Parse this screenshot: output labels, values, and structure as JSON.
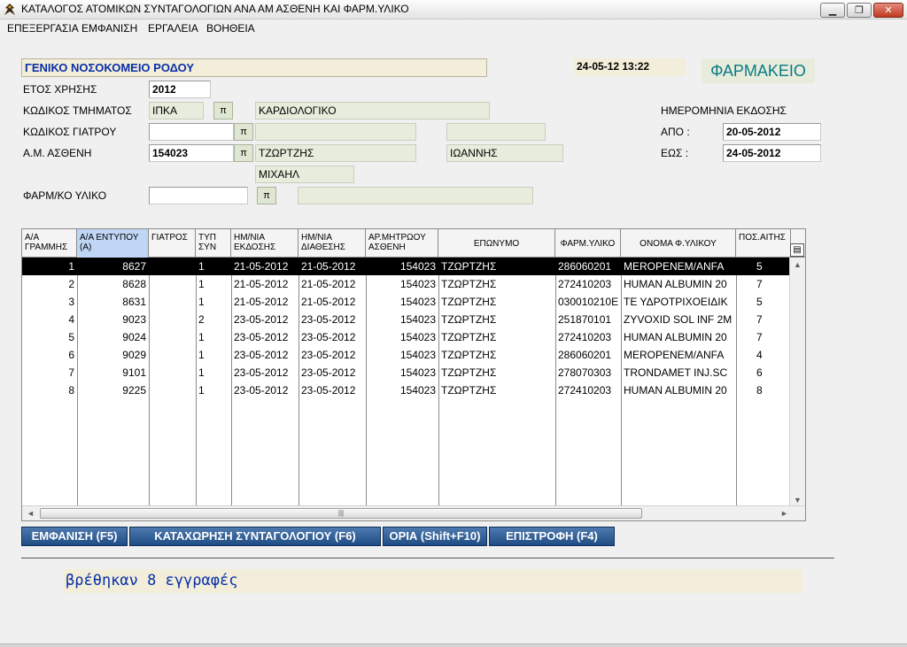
{
  "window": {
    "title": "ΚΑΤΑΛΟΓΟΣ  ΑΤΟΜΙΚΩΝ  ΣΥΝΤΑΓΟΛΟΓΙΩΝ  ΑΝΑ ΑΜ ΑΣΘΕΝΗ ΚΑΙ ΦΑΡΜ.ΥΛΙΚΟ",
    "minimize": "▁",
    "maximize": "❐",
    "close": "✕"
  },
  "menu": [
    "ΕΠΕΞΕΡΓΑΣΙΑ",
    "ΕΜΦΑΝΙΣΗ",
    "ΕΡΓΑΛΕΙΑ",
    "ΒΟΗΘΕΙΑ"
  ],
  "header": {
    "hospital": "ΓΕΝΙΚΟ ΝΟΣΟΚΟΜΕΙΟ ΡΟΔΟΥ",
    "datetime": "24-05-12 13:22",
    "pharmacy": "ΦΑΡΜΑΚΕΙΟ"
  },
  "form": {
    "year_label": "ΕΤΟΣ ΧΡΗΣΗΣ",
    "year_value": "2012",
    "dept_label": "ΚΩΔΙΚΟΣ ΤΜΗΜΑΤΟΣ",
    "dept_code": "ΙΠΚΑ",
    "dept_name": "ΚΑΡΔΙΟΛΟΓΙΚΟ",
    "doctor_label": "ΚΩΔΙΚΟΣ ΓΙΑΤΡΟΥ",
    "doctor_code": "",
    "doctor_surname": "",
    "doctor_firstname": "",
    "patient_label": "Α.Μ. ΑΣΘΕΝΗ",
    "patient_am": "154023",
    "patient_surname": "ΤΖΩΡΤΖΗΣ",
    "patient_firstname": "ΙΩΑΝΝΗΣ",
    "patient_father": "ΜΙΧΑΗΛ",
    "material_label": "ΦΑΡΜ/ΚΟ ΥΛΙΚΟ",
    "material_code": "",
    "material_name": "",
    "lookup_btn": "π",
    "issue_date_label": "ΗΜΕΡΟΜΗΝΙΑ ΕΚΔΟΣΗΣ",
    "from_label": "ΑΠΟ   :",
    "from_value": "20-05-2012",
    "to_label": "ΕΩΣ   :",
    "to_value": "24-05-2012"
  },
  "grid": {
    "columns": [
      "Α/Α ΓΡΑΜΜΗΣ",
      "Α/Α ΕΝΤΥΠΟΥ (Α)",
      "ΓΙΑΤΡΟΣ",
      "ΤΥΠ ΣΥΝ",
      "ΗΜ/ΝΙΑ ΕΚΔΟΣΗΣ",
      "ΗΜ/ΝΙΑ ΔΙΑΘΕΣΗΣ",
      "ΑΡ.ΜΗΤΡΩΟΥ ΑΣΘΕΝΗ",
      "ΕΠΩΝΥΜΟ",
      "ΦΑΡΜ.ΥΛΙΚΟ",
      "ΟΝΟΜΑ Φ.ΥΛΙΚΟΥ",
      "ΠΟΣ.ΑΙΤΗΣ"
    ],
    "rows": [
      [
        "1",
        "8627",
        "",
        "1",
        "21-05-2012",
        "21-05-2012",
        "154023",
        "ΤΖΩΡΤΖΗΣ",
        "286060201",
        "MEROPENEM/ANFA",
        "5"
      ],
      [
        "2",
        "8628",
        "",
        "1",
        "21-05-2012",
        "21-05-2012",
        "154023",
        "ΤΖΩΡΤΖΗΣ",
        "272410203",
        "HUMAN ALBUMIN 20",
        "7"
      ],
      [
        "3",
        "8631",
        "",
        "1",
        "21-05-2012",
        "21-05-2012",
        "154023",
        "ΤΖΩΡΤΖΗΣ",
        "030010210E",
        "ΤΕ ΥΔΡΟΤΡΙΧΟΕΙΔΙΚ",
        "5"
      ],
      [
        "4",
        "9023",
        "",
        "2",
        "23-05-2012",
        "23-05-2012",
        "154023",
        "ΤΖΩΡΤΖΗΣ",
        "251870101",
        "ZYVOXID SOL INF 2M",
        "7"
      ],
      [
        "5",
        "9024",
        "",
        "1",
        "23-05-2012",
        "23-05-2012",
        "154023",
        "ΤΖΩΡΤΖΗΣ",
        "272410203",
        "HUMAN ALBUMIN 20",
        "7"
      ],
      [
        "6",
        "9029",
        "",
        "1",
        "23-05-2012",
        "23-05-2012",
        "154023",
        "ΤΖΩΡΤΖΗΣ",
        "286060201",
        "MEROPENEM/ANFA",
        "4"
      ],
      [
        "7",
        "9101",
        "",
        "1",
        "23-05-2012",
        "23-05-2012",
        "154023",
        "ΤΖΩΡΤΖΗΣ",
        "278070303",
        "TRONDAMET INJ.SC",
        "6"
      ],
      [
        "8",
        "9225",
        "",
        "1",
        "23-05-2012",
        "23-05-2012",
        "154023",
        "ΤΖΩΡΤΖΗΣ",
        "272410203",
        "HUMAN ALBUMIN 20",
        "8"
      ]
    ],
    "selected_row": 0,
    "icons": {
      "scroll_up": "▲",
      "scroll_down": "▼",
      "scroll_left": "◄",
      "scroll_right": "►",
      "thumb_grip": "|||",
      "grid_menu": "▤"
    }
  },
  "actions": {
    "show": "ΕΜΦΑΝΙΣΗ (F5)",
    "register": "ΚΑΤΑΧΩΡΗΣΗ ΣΥΝΤΑΓΟΛΟΓΙΟΥ (F6)",
    "limits": "ΟΡΙΑ (Shift+F10)",
    "back": "ΕΠΙΣΤΡΟΦΗ (F4)"
  },
  "status": {
    "message": "βρέθηκαν 8 εγγραφές"
  }
}
